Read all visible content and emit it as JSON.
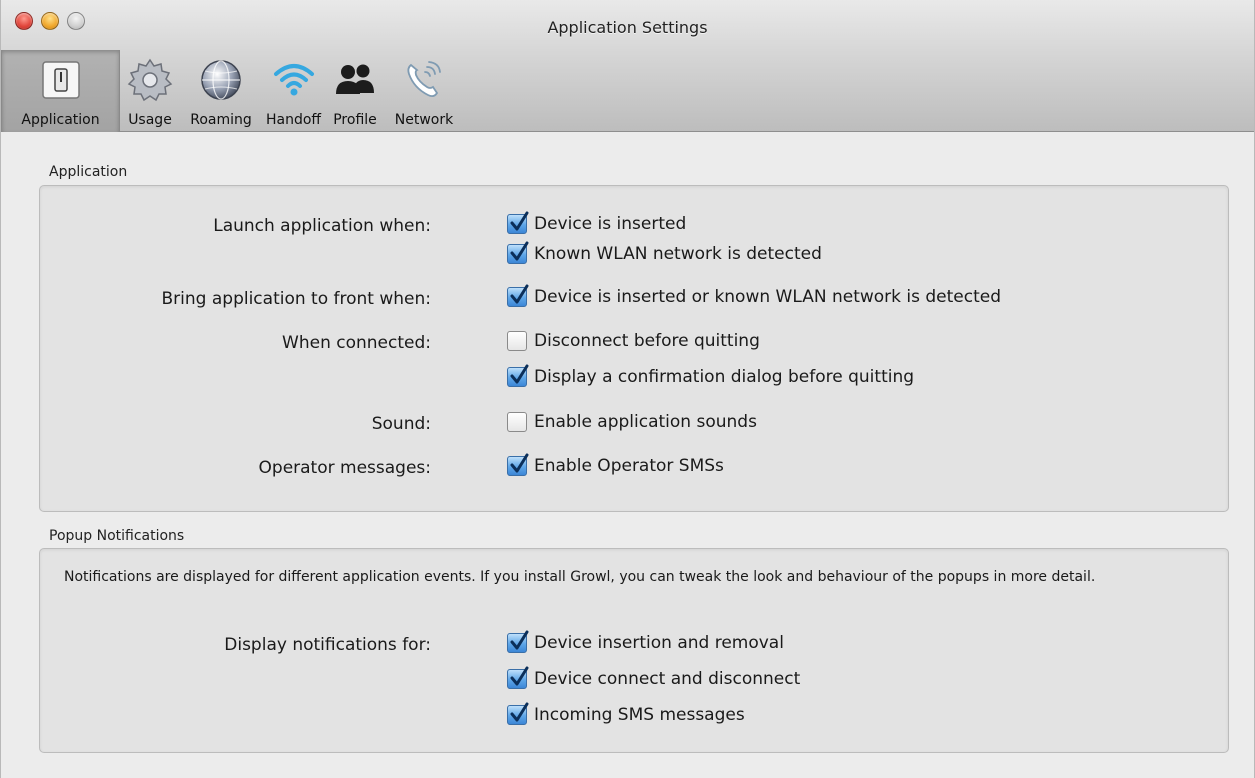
{
  "window": {
    "title": "Application Settings"
  },
  "toolbar": {
    "items": [
      {
        "label": "Application",
        "icon": "switch-icon",
        "selected": true
      },
      {
        "label": "Usage",
        "icon": "gear-icon"
      },
      {
        "label": "Roaming",
        "icon": "globe-icon"
      },
      {
        "label": "Handoff",
        "icon": "wifi-icon"
      },
      {
        "label": "Profile",
        "icon": "people-icon"
      },
      {
        "label": "Network",
        "icon": "phone-signal-icon"
      }
    ]
  },
  "application": {
    "group_title": "Application",
    "launch": {
      "label": "Launch application when:",
      "options": [
        {
          "text": "Device is inserted",
          "checked": true
        },
        {
          "text": "Known WLAN network is detected",
          "checked": true
        }
      ]
    },
    "front": {
      "label": "Bring application to front when:",
      "options": [
        {
          "text": "Device is inserted or known WLAN network is detected",
          "checked": true
        }
      ]
    },
    "connected": {
      "label": "When connected:",
      "options": [
        {
          "text": "Disconnect before quitting",
          "checked": false
        },
        {
          "text": "Display a confirmation dialog before quitting",
          "checked": true
        }
      ]
    },
    "sound": {
      "label": "Sound:",
      "options": [
        {
          "text": "Enable application sounds",
          "checked": false
        }
      ]
    },
    "operator": {
      "label": "Operator messages:",
      "options": [
        {
          "text": "Enable Operator SMSs",
          "checked": true
        }
      ]
    }
  },
  "popup": {
    "group_title": "Popup Notifications",
    "description": "Notifications are displayed for different application events. If you install Growl, you can tweak the look and behaviour of the popups in more detail.",
    "display": {
      "label": "Display notifications for:",
      "options": [
        {
          "text": "Device insertion and removal",
          "checked": true
        },
        {
          "text": "Device connect and disconnect",
          "checked": true
        },
        {
          "text": "Incoming SMS messages",
          "checked": true
        }
      ]
    }
  },
  "colors": {
    "checkbox_checked": "#5ea6e8",
    "window_bg": "#ececec",
    "group_bg": "#e3e3e3"
  }
}
